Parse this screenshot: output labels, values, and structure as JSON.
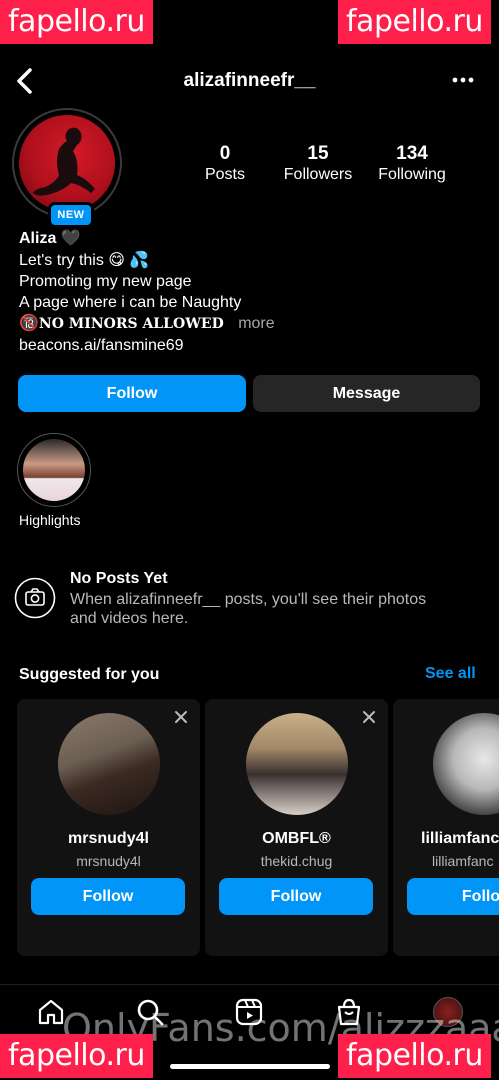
{
  "header": {
    "username": "alizafinneefr__"
  },
  "profile": {
    "badge": "NEW",
    "stats": [
      {
        "value": "0",
        "label": "Posts"
      },
      {
        "value": "15",
        "label": "Followers"
      },
      {
        "value": "134",
        "label": "Following"
      }
    ],
    "name": "Aliza",
    "name_emoji": "🖤",
    "bio_line1": "Let's try this 😋 💦",
    "bio_line2": "Promoting my new page",
    "bio_line3": "A page where i can be Naughty",
    "bio_line4_emoji": "🔞",
    "bio_line4": "NO MINORS ALLOWED",
    "more_label": "more",
    "link": "beacons.ai/fansmine69"
  },
  "actions": {
    "follow_label": "Follow",
    "message_label": "Message"
  },
  "highlights": {
    "label": "Highlights"
  },
  "no_posts": {
    "title": "No Posts Yet",
    "line1": "When alizafinneefr__ posts, you'll see their photos",
    "line2": "and videos here."
  },
  "suggested": {
    "title": "Suggested for you",
    "see_all": "See all",
    "cards": [
      {
        "name": "mrsnudy4l",
        "username": "mrsnudy4l",
        "follow": "Follow"
      },
      {
        "name": "OMBFL®",
        "username": "thekid.chug",
        "follow": "Follow"
      },
      {
        "name": "lilliamfanc",
        "username": "lilliamfanc",
        "follow": "Follo"
      }
    ]
  },
  "watermarks": {
    "site": "fapello.ru",
    "bottom_text": "OnlyFans.com/alizzzaaa"
  },
  "colors": {
    "accent": "#0095f6",
    "watermark": "#ff1f4b",
    "background": "#000000"
  }
}
